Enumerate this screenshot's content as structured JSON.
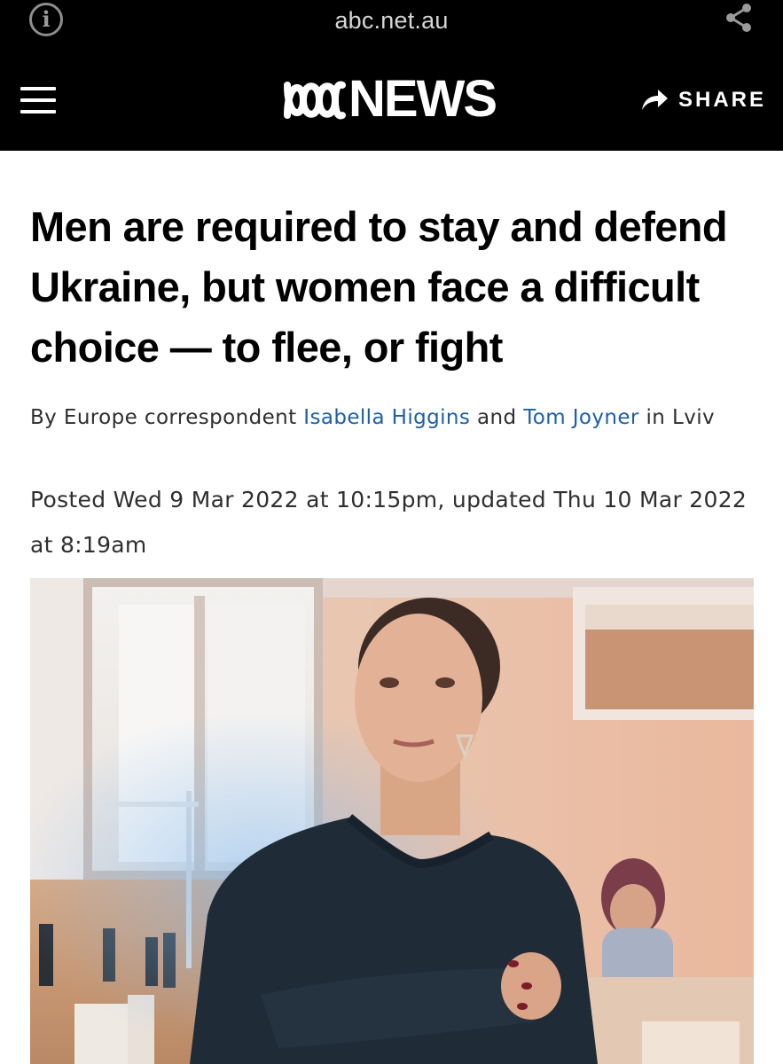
{
  "browser": {
    "url": "abc.net.au",
    "info_icon": "info-icon",
    "share_icon": "share-nodes-icon"
  },
  "header": {
    "menu_icon": "hamburger-menu-icon",
    "logo_text": "NEWS",
    "logo_icon": "abc-lissajous-logo-icon",
    "share_label": "SHARE",
    "share_icon": "share-arrow-icon",
    "background_color": "#000000"
  },
  "article": {
    "headline": "Men are required to stay and defend Ukraine, but women face a difficult choice — to flee, or fight",
    "byline": {
      "prefix": "By Europe correspondent ",
      "author1": "Isabella Higgins",
      "connector": " and ",
      "author2": "Tom Joyner",
      "suffix": " in Lviv",
      "link_color": "#1e5fa8"
    },
    "posted": "Posted Wed 9 Mar 2022 at 10:15pm, updated Thu 10 Mar 2022 at 8:19am"
  },
  "photo": {
    "description_icon": "article-photo"
  }
}
